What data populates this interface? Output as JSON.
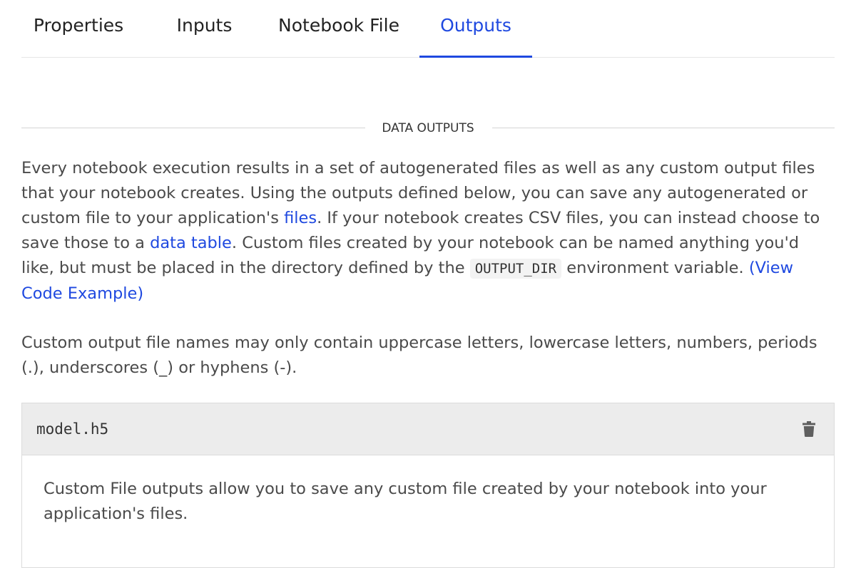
{
  "tabs": [
    {
      "label": "Properties",
      "active": false
    },
    {
      "label": "Inputs",
      "active": false
    },
    {
      "label": "Notebook File",
      "active": false
    },
    {
      "label": "Outputs",
      "active": true
    }
  ],
  "section": {
    "heading": "DATA OUTPUTS"
  },
  "intro": {
    "p1_text1": "Every notebook execution results in a set of autogenerated files as well as any custom output files that your notebook creates. Using the outputs defined below, you can save any autogenerated or custom file to your application's ",
    "files_link": "files",
    "p1_text2": ". If your notebook creates CSV files, you can instead choose to save those to a ",
    "data_table_link": "data table",
    "p1_text3": ". Custom files created by your notebook can be named anything you'd like, but must be placed in the directory defined by the ",
    "env_var": "OUTPUT_DIR",
    "p1_text4": " environment variable. ",
    "code_example_link": "(View Code Example)",
    "p2": "Custom output file names may only contain uppercase letters, lowercase letters, numbers, periods (.), underscores (_) or hyphens (-)."
  },
  "output_card": {
    "filename": "model.h5",
    "delete_icon": "trash-icon",
    "description": "Custom File outputs allow you to save any custom file created by your notebook into your application's files."
  },
  "colors": {
    "accent": "#1f49e0",
    "text": "#4a4a4a",
    "card_header_bg": "#ececec"
  }
}
